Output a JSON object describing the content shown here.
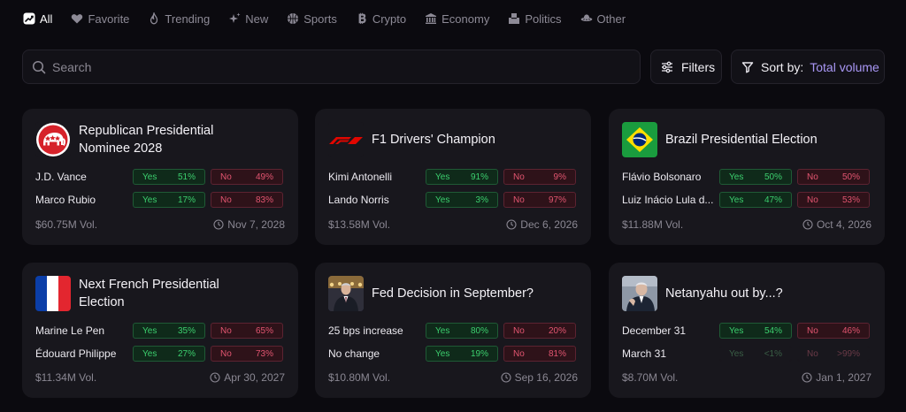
{
  "tabs": [
    {
      "label": "All",
      "icon": "trending-chart-icon",
      "active": true
    },
    {
      "label": "Favorite",
      "icon": "heart-icon"
    },
    {
      "label": "Trending",
      "icon": "flame-icon"
    },
    {
      "label": "New",
      "icon": "sparkles-icon"
    },
    {
      "label": "Sports",
      "icon": "basketball-icon"
    },
    {
      "label": "Crypto",
      "icon": "bitcoin-icon"
    },
    {
      "label": "Economy",
      "icon": "bank-icon"
    },
    {
      "label": "Politics",
      "icon": "ballot-box-icon"
    },
    {
      "label": "Other",
      "icon": "ufo-icon"
    }
  ],
  "search": {
    "placeholder": "Search"
  },
  "filters": {
    "label": "Filters"
  },
  "sort": {
    "prefix": "Sort by:",
    "value": "Total volume"
  },
  "colors": {
    "accent": "#a997f5",
    "yes": "#3ccf6e",
    "no": "#e25570",
    "card": "#18171d"
  },
  "markets": [
    {
      "title": "Republican Presidential Nominee 2028",
      "icon": "gop-elephant-icon",
      "outcomes": [
        {
          "name": "J.D. Vance",
          "yes_label": "Yes",
          "yes": "51%",
          "no_label": "No",
          "no": "49%"
        },
        {
          "name": "Marco Rubio",
          "yes_label": "Yes",
          "yes": "17%",
          "no_label": "No",
          "no": "83%"
        }
      ],
      "volume": "$60.75M Vol.",
      "date": "Nov 7, 2028"
    },
    {
      "title": "F1 Drivers' Champion",
      "icon": "f1-logo-icon",
      "outcomes": [
        {
          "name": "Kimi Antonelli",
          "yes_label": "Yes",
          "yes": "91%",
          "no_label": "No",
          "no": "9%"
        },
        {
          "name": "Lando Norris",
          "yes_label": "Yes",
          "yes": "3%",
          "no_label": "No",
          "no": "97%"
        }
      ],
      "volume": "$13.58M Vol.",
      "date": "Dec 6, 2026"
    },
    {
      "title": "Brazil Presidential Election",
      "icon": "brazil-flag-icon",
      "outcomes": [
        {
          "name": "Flávio Bolsonaro",
          "yes_label": "Yes",
          "yes": "50%",
          "no_label": "No",
          "no": "50%"
        },
        {
          "name": "Luiz Inácio Lula d...",
          "yes_label": "Yes",
          "yes": "47%",
          "no_label": "No",
          "no": "53%"
        }
      ],
      "volume": "$11.88M Vol.",
      "date": "Oct 4, 2026"
    },
    {
      "title": "Next French Presidential Election",
      "icon": "france-flag-icon",
      "outcomes": [
        {
          "name": "Marine Le Pen",
          "yes_label": "Yes",
          "yes": "35%",
          "no_label": "No",
          "no": "65%"
        },
        {
          "name": "Édouard Philippe",
          "yes_label": "Yes",
          "yes": "27%",
          "no_label": "No",
          "no": "73%"
        }
      ],
      "volume": "$11.34M Vol.",
      "date": "Apr 30, 2027"
    },
    {
      "title": "Fed Decision in September?",
      "icon": "fed-chair-photo-icon",
      "outcomes": [
        {
          "name": "25 bps increase",
          "yes_label": "Yes",
          "yes": "80%",
          "no_label": "No",
          "no": "20%"
        },
        {
          "name": "No change",
          "yes_label": "Yes",
          "yes": "19%",
          "no_label": "No",
          "no": "81%"
        }
      ],
      "volume": "$10.80M Vol.",
      "date": "Sep 16, 2026"
    },
    {
      "title": "Netanyahu out by...?",
      "icon": "netanyahu-photo-icon",
      "outcomes": [
        {
          "name": "December 31",
          "yes_label": "Yes",
          "yes": "54%",
          "no_label": "No",
          "no": "46%"
        },
        {
          "name": "March 31",
          "yes_label": "Yes",
          "yes": "<1%",
          "no_label": "No",
          "no": ">99%",
          "faded": true
        }
      ],
      "volume": "$8.70M Vol.",
      "date": "Jan 1, 2027"
    }
  ]
}
